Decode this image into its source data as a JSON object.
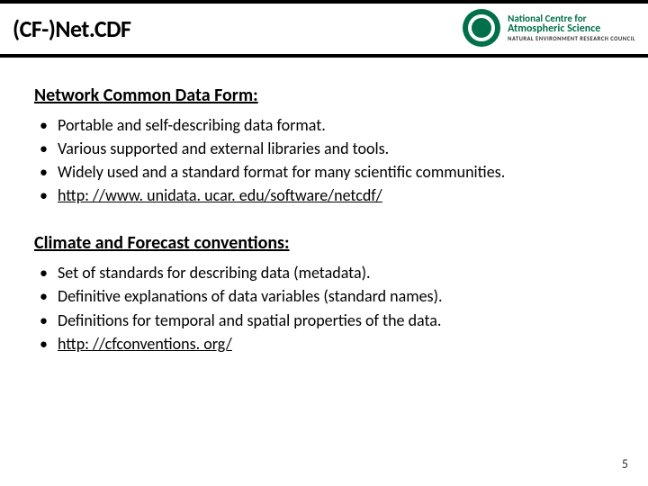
{
  "header": {
    "title": "(CF-)Net.CDF",
    "org": {
      "line1": "National Centre for",
      "line2": "Atmospheric Science",
      "line3": "NATURAL ENVIRONMENT RESEARCH COUNCIL"
    }
  },
  "section1": {
    "heading_parts": [
      "Net",
      "work ",
      "C",
      "ommon ",
      "D",
      "ata ",
      "F",
      "orm:"
    ],
    "bullets": [
      "Portable and self-describing data format.",
      "Various supported and external libraries and tools.",
      "Widely used and a standard format for many scientific communities.",
      "http: //www. unidata. ucar. edu/software/netcdf/"
    ]
  },
  "section2": {
    "heading_parts": [
      "C",
      "limate and ",
      "F",
      "orecast conventions:"
    ],
    "bullets": [
      "Set of standards for describing data (metadata).",
      "Definitive explanations of data variables (standard names).",
      "Definitions for temporal and spatial properties of the data.",
      "http: //cfconventions. org/"
    ]
  },
  "page_number": "5"
}
